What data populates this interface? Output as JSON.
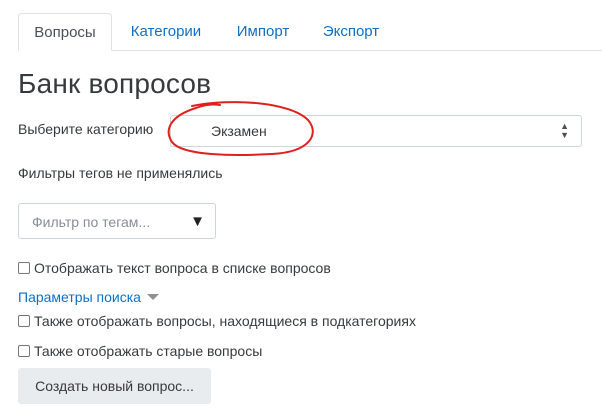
{
  "tabs": [
    {
      "label": "Вопросы",
      "active": true
    },
    {
      "label": "Категории"
    },
    {
      "label": "Импорт"
    },
    {
      "label": "Экспорт"
    }
  ],
  "page_title": "Банк вопросов",
  "category": {
    "label": "Выберите категорию",
    "selected": "Экзамен",
    "highlight_color": "#e0201d"
  },
  "tag_filter": {
    "status_text": "Фильтры тегов не применялись",
    "placeholder": "Фильтр по тегам..."
  },
  "options": {
    "show_question_text": {
      "label": "Отображать текст вопроса в списке вопросов",
      "checked": false
    }
  },
  "search_params": {
    "label": "Параметры поиска",
    "include_subcategories": {
      "label": "Также отображать вопросы, находящиеся в подкатегориях",
      "checked": false
    },
    "show_old": {
      "label": "Также отображать старые вопросы",
      "checked": false
    }
  },
  "create_button": {
    "label": "Создать новый вопрос..."
  },
  "colors": {
    "link": "#0f6fc5",
    "text": "#373a3c",
    "button_bg": "#e9ecef"
  }
}
